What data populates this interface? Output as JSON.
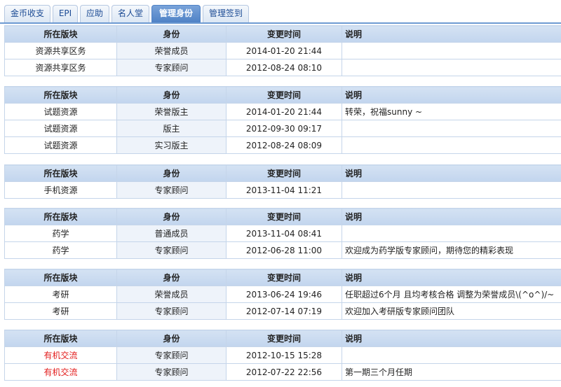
{
  "tabs": [
    {
      "label": "金币收支",
      "active": false
    },
    {
      "label": "EPI",
      "active": false
    },
    {
      "label": "应助",
      "active": false
    },
    {
      "label": "名人堂",
      "active": false
    },
    {
      "label": "管理身份",
      "active": true
    },
    {
      "label": "管理签到",
      "active": false
    }
  ],
  "headers": {
    "section": "所在版块",
    "role": "身份",
    "time": "变更时间",
    "note": "说明"
  },
  "groups": [
    {
      "rows": [
        {
          "section": "资源共享区务",
          "role": "荣誉成员",
          "time": "2014-01-20 21:44",
          "note": ""
        },
        {
          "section": "资源共享区务",
          "role": "专家顾问",
          "time": "2012-08-24 08:10",
          "note": ""
        }
      ]
    },
    {
      "rows": [
        {
          "section": "试题资源",
          "role": "荣誉版主",
          "time": "2014-01-20 21:44",
          "note": "转荣，祝福sunny ~"
        },
        {
          "section": "试题资源",
          "role": "版主",
          "time": "2012-09-30 09:17",
          "note": ""
        },
        {
          "section": "试题资源",
          "role": "实习版主",
          "time": "2012-08-24 08:09",
          "note": ""
        }
      ]
    },
    {
      "rows": [
        {
          "section": "手机资源",
          "role": "专家顾问",
          "time": "2013-11-04 11:21",
          "note": ""
        }
      ]
    },
    {
      "rows": [
        {
          "section": "药学",
          "role": "普通成员",
          "time": "2013-11-04 08:41",
          "note": ""
        },
        {
          "section": "药学",
          "role": "专家顾问",
          "time": "2012-06-28 11:00",
          "note": "欢迎成为药学版专家顾问，期待您的精彩表现"
        }
      ]
    },
    {
      "rows": [
        {
          "section": "考研",
          "role": "荣誉成员",
          "time": "2013-06-24 19:46",
          "note": "任职超过6个月 且均考核合格 调整为荣誉成员\\(^o^)/~"
        },
        {
          "section": "考研",
          "role": "专家顾问",
          "time": "2012-07-14 07:19",
          "note": "欢迎加入考研版专家顾问团队"
        }
      ]
    },
    {
      "rows": [
        {
          "section": "有机交流",
          "role": "专家顾问",
          "time": "2012-10-15 15:28",
          "note": ""
        },
        {
          "section": "有机交流",
          "role": "专家顾问",
          "time": "2012-07-22 22:56",
          "note": "第一期三个月任期"
        }
      ],
      "section_color": "#e21a1a"
    }
  ],
  "colors": {
    "accent": "#4f82c6",
    "header_bg": "#c2d5ee",
    "highlight_red": "#e21a1a"
  }
}
